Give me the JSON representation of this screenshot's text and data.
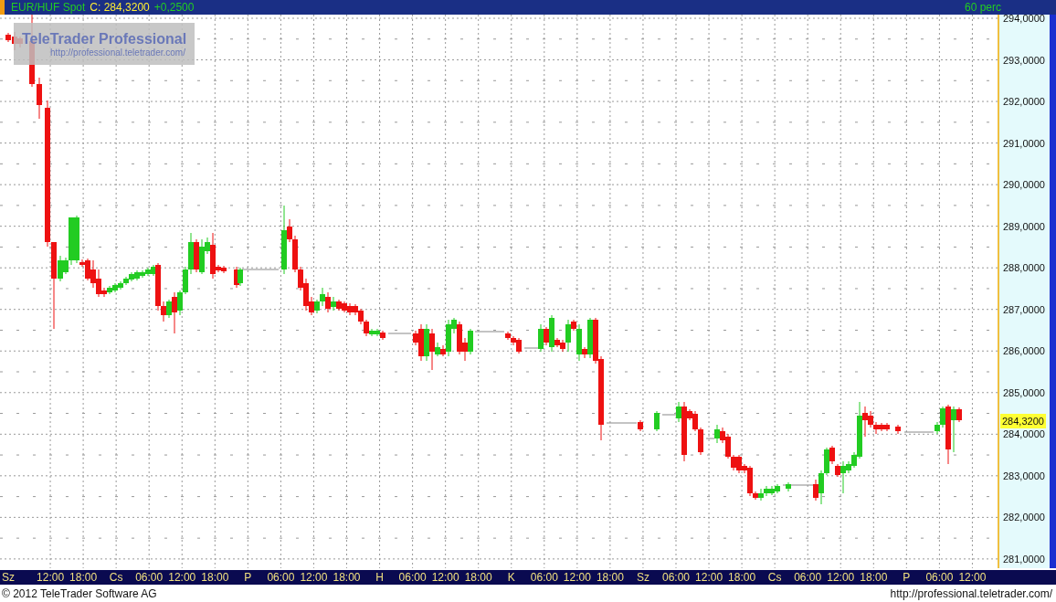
{
  "header": {
    "instrument": "EUR/HUF Spot",
    "close": "C: 284,3200",
    "change": "+0,2500",
    "interval": "60 perc"
  },
  "logo": {
    "title": "TeleTrader Professional",
    "url": "http://professional.teletrader.com/"
  },
  "y_axis": {
    "labels": [
      "294,0000",
      "293,0000",
      "292,0000",
      "291,0000",
      "290,0000",
      "289,0000",
      "288,0000",
      "287,0000",
      "286,0000",
      "285,0000",
      "284,0000",
      "283,0000",
      "282,0000",
      "281,0000"
    ],
    "current_price": "284,3200"
  },
  "x_axis": {
    "labels": [
      "Sz",
      "12:00",
      "18:00",
      "Cs",
      "06:00",
      "12:00",
      "18:00",
      "P",
      "06:00",
      "12:00",
      "18:00",
      "H",
      "06:00",
      "12:00",
      "18:00",
      "K",
      "06:00",
      "12:00",
      "18:00",
      "Sz",
      "06:00",
      "12:00",
      "18:00",
      "Cs",
      "06:00",
      "12:00",
      "18:00",
      "P",
      "06:00",
      "12:00"
    ]
  },
  "footer": {
    "copyright": "© 2012 TeleTrader Software AG",
    "url": "http://professional.teletrader.com/"
  }
}
